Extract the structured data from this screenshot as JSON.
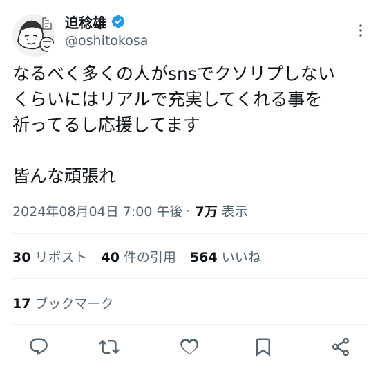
{
  "author": {
    "name": "迫稔雄",
    "handle": "@oshitokosa"
  },
  "tweet": {
    "text": "なるべく多くの人がsnsでクソリプしない\nくらいにはリアルで充実してくれる事を\n祈ってるし応援してます\n\n皆んな頑張れ",
    "timestamp": "2024年08月04日 7:00 午後",
    "views_count": "7万",
    "views_label": "表示"
  },
  "stats": {
    "retweets": "30",
    "retweets_label": "リポスト",
    "quotes": "40",
    "quotes_label": "件の引用",
    "likes": "564",
    "likes_label": "いいね",
    "bookmarks": "17",
    "bookmarks_label": "ブックマーク"
  },
  "colors": {
    "verified": "#1d9bf0",
    "secondary_text": "#536471",
    "icon": "#536471"
  },
  "icons": {
    "verified": "verified-badge-icon",
    "more": "more-icon",
    "reply": "reply-icon",
    "retweet": "retweet-icon",
    "like": "heart-icon",
    "bookmark": "bookmark-icon",
    "share": "share-icon"
  }
}
